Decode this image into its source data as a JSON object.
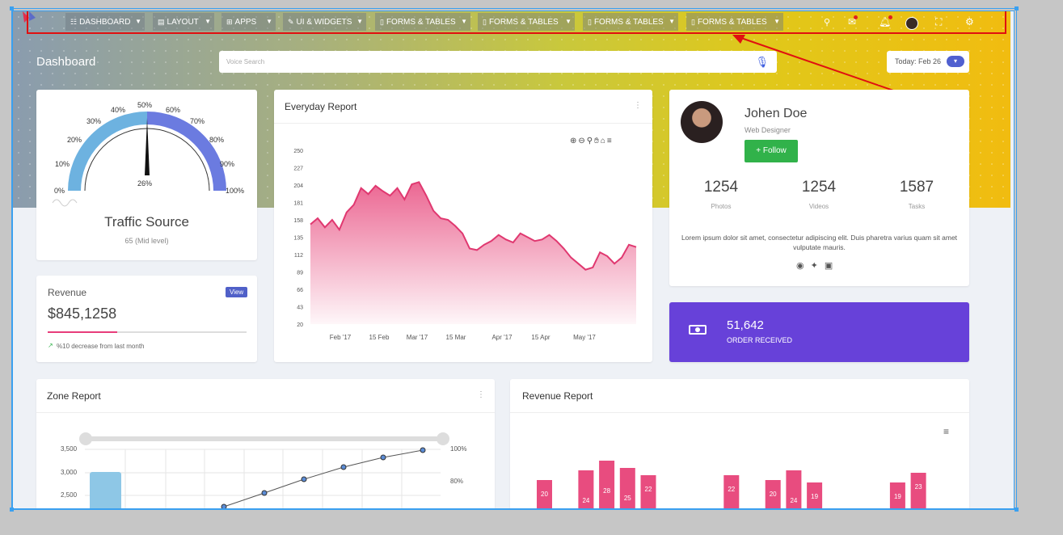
{
  "nav": [
    {
      "icon": "☷",
      "label": "DASHBOARD"
    },
    {
      "icon": "▤",
      "label": "LAYOUT"
    },
    {
      "icon": "⊞",
      "label": "APPS"
    },
    {
      "icon": "✎",
      "label": "UI & WIDGETS"
    },
    {
      "icon": "▯",
      "label": "FORMS & TABLES"
    },
    {
      "icon": "▯",
      "label": "FORMS & TABLES"
    },
    {
      "icon": "▯",
      "label": "FORMS & TABLES"
    },
    {
      "icon": "▯",
      "label": "FORMS & TABLES"
    }
  ],
  "page_title": "Dashboard",
  "search": {
    "placeholder": "Voice Search"
  },
  "date": {
    "label": "Today: Feb 26"
  },
  "gauge": {
    "title": "Traffic Source",
    "subtitle": "65 (Mid level)",
    "value_label": "26%",
    "ticks": [
      "0%",
      "10%",
      "20%",
      "30%",
      "40%",
      "50%",
      "60%",
      "70%",
      "80%",
      "90%",
      "100%"
    ]
  },
  "revenue": {
    "label": "Revenue",
    "value": "$845,1258",
    "button": "View",
    "note": "%10 decrease from last month",
    "progress": 0.35
  },
  "everyday": {
    "title": "Everyday Report",
    "y_ticks": [
      "250",
      "227",
      "204",
      "181",
      "158",
      "135",
      "112",
      "89",
      "66",
      "43",
      "20"
    ],
    "x_ticks": [
      "Feb '17",
      "15 Feb",
      "Mar '17",
      "15 Mar",
      "Apr '17",
      "15 Apr",
      "May '17"
    ]
  },
  "profile": {
    "name": "Johen Doe",
    "role": "Web Designer",
    "follow": "+ Follow",
    "stats": [
      {
        "n": "1254",
        "l": "Photos"
      },
      {
        "n": "1254",
        "l": "Videos"
      },
      {
        "n": "1587",
        "l": "Tasks"
      }
    ],
    "bio": "Lorem ipsum dolor sit amet, consectetur adipiscing elit. Duis pharetra varius quam sit amet vulputate mauris."
  },
  "orders": {
    "value": "51,642",
    "label": "ORDER RECEIVED"
  },
  "zone": {
    "title": "Zone Report",
    "y_left": [
      "3,500",
      "3,000",
      "2,500"
    ],
    "y_right": [
      "100%",
      "80%"
    ]
  },
  "revrep": {
    "title": "Revenue Report"
  },
  "chart_data": [
    {
      "type": "area",
      "title": "Everyday Report",
      "ylim": [
        20,
        250
      ],
      "x_range": [
        "Feb '17",
        "May '17"
      ],
      "values": [
        152,
        160,
        148,
        158,
        145,
        168,
        178,
        200,
        192,
        203,
        196,
        190,
        200,
        185,
        205,
        208,
        190,
        170,
        160,
        158,
        150,
        140,
        120,
        118,
        125,
        130,
        138,
        132,
        128,
        140,
        135,
        130,
        132,
        138,
        130,
        120,
        108,
        100,
        92,
        95,
        115,
        110,
        100,
        108,
        125,
        122
      ]
    },
    {
      "type": "bar",
      "title": "Revenue Report",
      "values": [
        20,
        null,
        24,
        28,
        25,
        22,
        null,
        null,
        null,
        22,
        null,
        20,
        24,
        19,
        null,
        null,
        null,
        19,
        23
      ]
    },
    {
      "type": "line",
      "title": "Zone Report",
      "y_left_ticks": [
        "3,500",
        "3,000",
        "2,500"
      ],
      "y_right_ticks": [
        "100%",
        "80%"
      ]
    }
  ],
  "colors": {
    "accent": "#5b6fd6",
    "pink": "#e84c7f",
    "green": "#31b24a",
    "purple": "#6741d9"
  }
}
